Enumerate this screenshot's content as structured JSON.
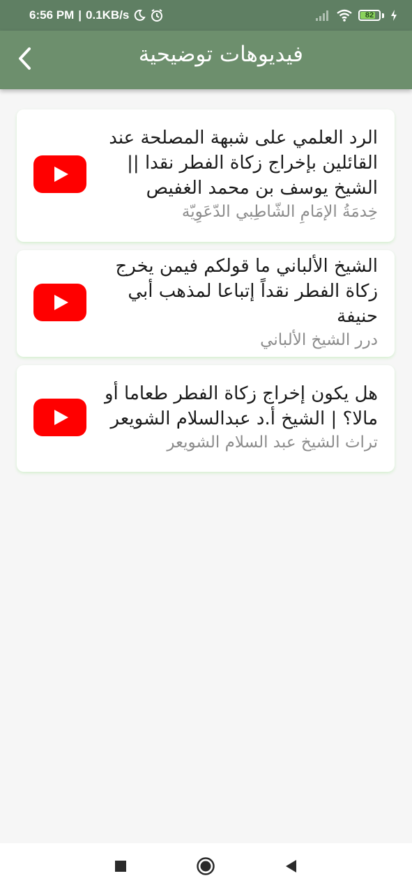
{
  "status_bar": {
    "time": "6:56 PM",
    "separator": "|",
    "speed": "0.1KB/s",
    "battery": "82",
    "battery_level": 0.82
  },
  "app_bar": {
    "title": "فيديوهات توضيحية",
    "back_icon": "chevron-left-icon"
  },
  "videos": [
    {
      "title": "الرد العلمي على شبهة المصلحة عند القائلين بإخراج زكاة الفطر نقدا || الشيخ يوسف بن محمد الغفيص",
      "channel": "خِدمَةُ الإمَامِ الشّاطِبي الدّعَوِيّة",
      "icon": "youtube-icon"
    },
    {
      "title": "الشيخ الألباني ما قولكم فيمن يخرج زكاة الفطر نقداً إتباعا لمذهب أبي حنيفة",
      "channel": "درر الشيخ الألباني",
      "icon": "youtube-icon"
    },
    {
      "title": "هل يكون إخراج زكاة الفطر طعاما أو مالا؟ | الشيخ أ.د عبدالسلام الشويعر",
      "channel": "تراث الشيخ عبد السلام الشويعر",
      "icon": "youtube-icon"
    }
  ],
  "nav_bar": {
    "recents_icon": "square-icon",
    "home_icon": "circle-icon",
    "back_icon": "triangle-back-icon"
  },
  "colors": {
    "status_bar": "#5f7f63",
    "app_bar": "#6d8f6d",
    "youtube_red": "#ff0000",
    "background": "#f6f6f6"
  }
}
